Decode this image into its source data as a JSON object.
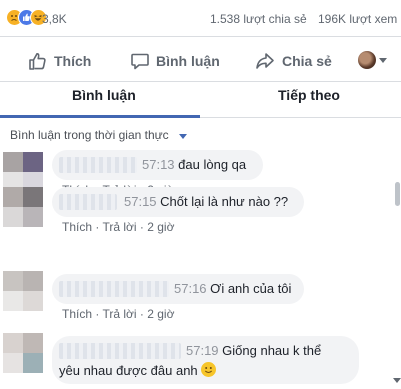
{
  "stats": {
    "reactions": [
      "sad-reaction-icon",
      "like-reaction-icon",
      "haha-reaction-icon"
    ],
    "reaction_count": "3,8K",
    "shares": "1.538 lượt chia sẻ",
    "views": "196K lượt xem"
  },
  "actions": {
    "like": "Thích",
    "comment": "Bình luận",
    "share": "Chia sẻ"
  },
  "tabs": {
    "comments": "Bình luận",
    "next": "Tiếp theo"
  },
  "filter": {
    "label": "Bình luận trong thời gian thực"
  },
  "colors": {
    "accent": "#4267b2",
    "bubble": "#f2f3f5",
    "muted": "#606770"
  },
  "comments": [
    {
      "time": "57:13",
      "text": "đau lòng qa",
      "like": "Thích",
      "reply": "Trả lời",
      "age": "2 giờ"
    },
    {
      "time": "57:15",
      "text": "Chốt lại là như nào ??",
      "like": "Thích",
      "reply": "Trả lời",
      "age": "2 giờ"
    },
    {
      "time": "57:16",
      "text": "Ơi anh của tôi",
      "like": "Thích",
      "reply": "Trả lời",
      "age": "2 giờ"
    },
    {
      "time": "57:19",
      "text": "Giống nhau k thể",
      "text2": "yêu nhau được đâu anh",
      "like": "Thích",
      "reply": "Trả lời",
      "age": "2 giờ"
    }
  ]
}
